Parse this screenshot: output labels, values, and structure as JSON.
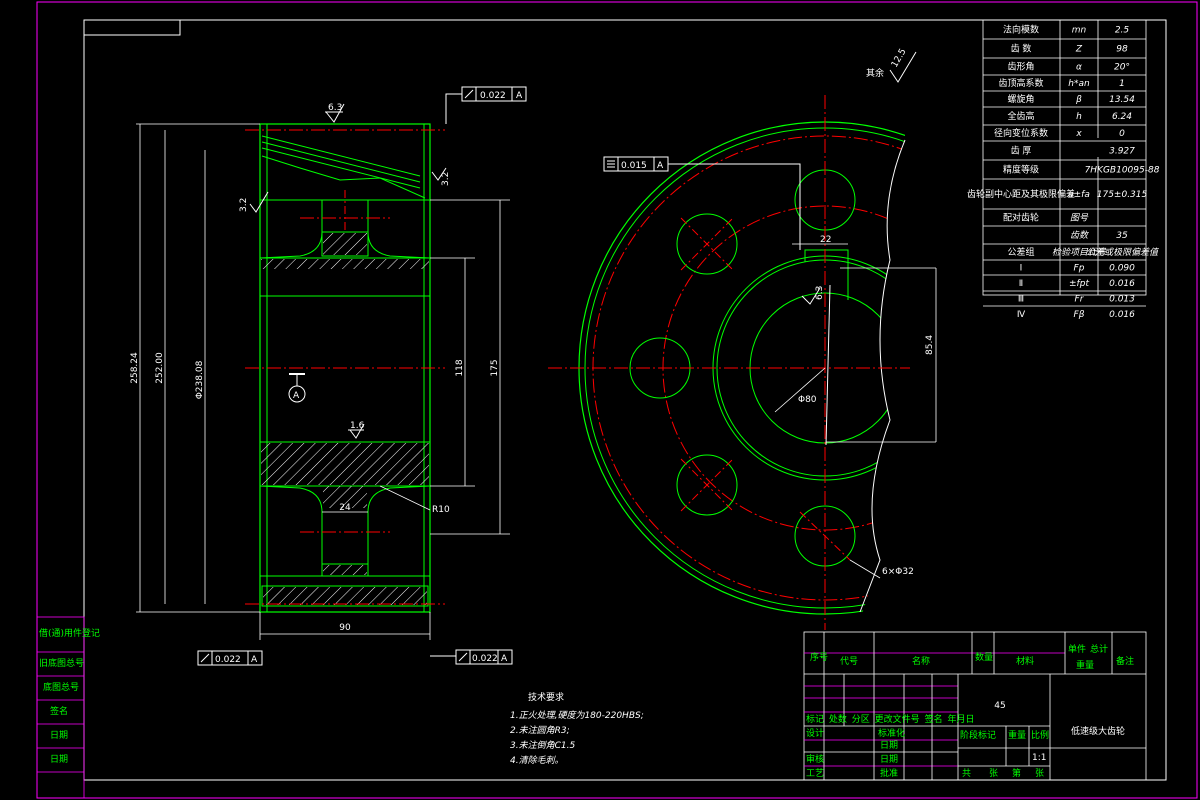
{
  "colors": {
    "background": "#000000",
    "frame": "#ffffff",
    "outline": "#00ff00",
    "center_line": "#ff0000",
    "dimension": "#ffffff",
    "border": "#ff00ff"
  },
  "roughness": {
    "other_prefix": "其余",
    "other_value": "12.5",
    "face_top": "6.3",
    "face_bottom": "1.6",
    "tooth": "3.2",
    "hub": "3.2",
    "keyway_side": "6.3"
  },
  "tolerance": {
    "runout_right_top": "0.022",
    "runout_left_bottom": "0.022",
    "runout_right_bottom": "0.022",
    "datum": "A",
    "keyway_symmetry": "0.015",
    "datum_label": "A"
  },
  "dimensions": {
    "d_tip": "258.24",
    "d_pitch": "252.00",
    "d_root": "Φ238.08",
    "d_bore_hub": "118",
    "d_web_outer": "175",
    "width": "90",
    "web_thickness": "24",
    "fillet": "R10",
    "key_width": "22",
    "bore": "Φ80",
    "key_depth": "85.4",
    "holes": "6×Φ32"
  },
  "gear_table": [
    {
      "name": "法向模数",
      "symbol": "mn",
      "value": "2.5"
    },
    {
      "name": "齿  数",
      "symbol": "Z",
      "value": "98"
    },
    {
      "name": "齿形角",
      "symbol": "α",
      "value": "20°"
    },
    {
      "name": "齿顶高系数",
      "symbol": "h*an",
      "value": "1"
    },
    {
      "name": "螺旋角",
      "symbol": "β",
      "value": "13.54"
    },
    {
      "name": "全齿高",
      "symbol": "h",
      "value": "6.24"
    },
    {
      "name": "径向变位系数",
      "symbol": "x",
      "value": "0"
    },
    {
      "name": "齿  厚",
      "symbol": "",
      "value": "3.927"
    },
    {
      "name": "精度等级",
      "symbol": "",
      "value": "7HKGB10095-88"
    },
    {
      "name": "齿轮副中心距及其极限偏差",
      "symbol": "a±fa",
      "value": "175±0.315"
    },
    {
      "name": "配对齿轮",
      "symbol": "图号",
      "value": ""
    },
    {
      "name": "",
      "symbol": "齿数",
      "value": "35"
    },
    {
      "name": "公差组",
      "symbol": "检验项目代号",
      "value": "公差或极限偏差值"
    },
    {
      "name": "Ⅰ",
      "symbol": "Fp",
      "value": "0.090"
    },
    {
      "name": "Ⅱ",
      "symbol": "±fpt",
      "value": "0.016"
    },
    {
      "name": "Ⅲ",
      "symbol": "Fr",
      "value": "0.013"
    },
    {
      "name": "Ⅳ",
      "symbol": "Fβ",
      "value": "0.016"
    }
  ],
  "tech": {
    "title": "技术要求",
    "items": [
      "1.正火处理,硬度为180-220HBS;",
      "2.未注圆角R3;",
      "3.未注倒角C1.5",
      "4.清除毛刺。"
    ]
  },
  "left_strip": [
    "借(通)用件登记",
    "旧底图总号",
    "底图总号",
    "签名",
    "日期",
    "日期"
  ],
  "title_block": {
    "parts_headers": [
      "序号",
      "代号",
      "名称",
      "数量",
      "材料",
      "单件",
      "总计",
      "重量",
      "备注"
    ],
    "material": "45",
    "drawing_name": "低速级大齿轮",
    "change_row": [
      "标记",
      "处数",
      "分区",
      "更改文件号",
      "签名",
      "年月日"
    ],
    "roles": [
      "设计",
      "审核",
      "工艺"
    ],
    "roles2": [
      "标准化",
      "批准"
    ],
    "std_headers": [
      "阶段标记",
      "重量",
      "比例"
    ],
    "scale": "1:1",
    "sheet": [
      "共",
      "张",
      "第",
      "张"
    ],
    "dates": [
      "日期",
      "日期",
      "日期"
    ]
  }
}
